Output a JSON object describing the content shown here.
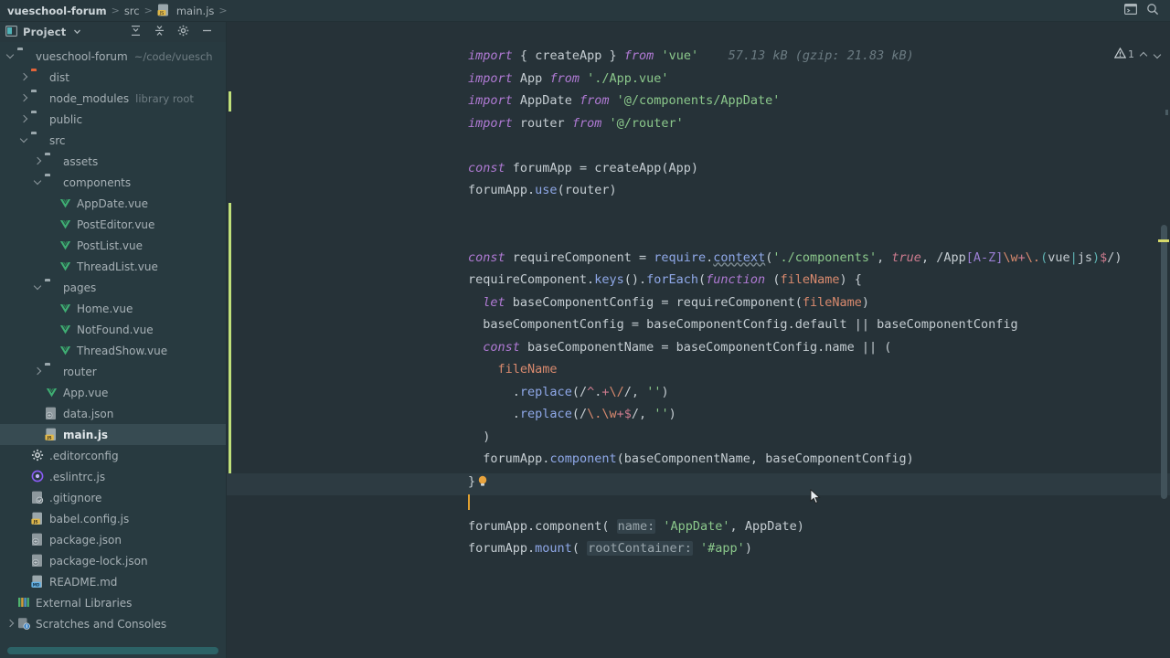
{
  "window": {
    "breadcrumbs": [
      {
        "label": "vueschool-forum",
        "bold": true,
        "icon": "none"
      },
      {
        "label": "src",
        "bold": false,
        "icon": "none"
      },
      {
        "label": "main.js",
        "bold": false,
        "icon": "js-file-icon"
      }
    ],
    "separator": ">",
    "right_icons": [
      {
        "name": "terminal-window-icon"
      },
      {
        "name": "search-icon"
      }
    ]
  },
  "sidebar": {
    "title": "Project",
    "dropdown_icon": "chevron-down-icon",
    "tools": [
      {
        "name": "expand-all-icon"
      },
      {
        "name": "collapse-all-icon"
      },
      {
        "name": "settings-gear-icon"
      },
      {
        "name": "hide-panel-icon"
      }
    ],
    "tree": [
      {
        "label": "vueschool-forum",
        "hint": "~/code/vuesch",
        "depth": 0,
        "arrow": "open",
        "icon": "folder",
        "selected": false
      },
      {
        "label": "dist",
        "hint": "",
        "depth": 1,
        "arrow": "closed",
        "icon": "folder-orange",
        "selected": false
      },
      {
        "label": "node_modules",
        "hint": "library root",
        "depth": 1,
        "arrow": "closed",
        "icon": "folder",
        "selected": false
      },
      {
        "label": "public",
        "hint": "",
        "depth": 1,
        "arrow": "closed",
        "icon": "folder",
        "selected": false
      },
      {
        "label": "src",
        "hint": "",
        "depth": 1,
        "arrow": "open",
        "icon": "folder",
        "selected": false
      },
      {
        "label": "assets",
        "hint": "",
        "depth": 2,
        "arrow": "closed",
        "icon": "folder",
        "selected": false
      },
      {
        "label": "components",
        "hint": "",
        "depth": 2,
        "arrow": "open",
        "icon": "folder",
        "selected": false
      },
      {
        "label": "AppDate.vue",
        "hint": "",
        "depth": 3,
        "arrow": "none",
        "icon": "vue-file-icon",
        "selected": false
      },
      {
        "label": "PostEditor.vue",
        "hint": "",
        "depth": 3,
        "arrow": "none",
        "icon": "vue-file-icon",
        "selected": false
      },
      {
        "label": "PostList.vue",
        "hint": "",
        "depth": 3,
        "arrow": "none",
        "icon": "vue-file-icon",
        "selected": false
      },
      {
        "label": "ThreadList.vue",
        "hint": "",
        "depth": 3,
        "arrow": "none",
        "icon": "vue-file-icon",
        "selected": false
      },
      {
        "label": "pages",
        "hint": "",
        "depth": 2,
        "arrow": "open",
        "icon": "folder",
        "selected": false
      },
      {
        "label": "Home.vue",
        "hint": "",
        "depth": 3,
        "arrow": "none",
        "icon": "vue-file-icon",
        "selected": false
      },
      {
        "label": "NotFound.vue",
        "hint": "",
        "depth": 3,
        "arrow": "none",
        "icon": "vue-file-icon",
        "selected": false
      },
      {
        "label": "ThreadShow.vue",
        "hint": "",
        "depth": 3,
        "arrow": "none",
        "icon": "vue-file-icon",
        "selected": false
      },
      {
        "label": "router",
        "hint": "",
        "depth": 2,
        "arrow": "closed",
        "icon": "folder",
        "selected": false
      },
      {
        "label": "App.vue",
        "hint": "",
        "depth": 2,
        "arrow": "none",
        "icon": "vue-file-icon",
        "selected": false
      },
      {
        "label": "data.json",
        "hint": "",
        "depth": 2,
        "arrow": "none",
        "icon": "json-file-icon",
        "selected": false
      },
      {
        "label": "main.js",
        "hint": "",
        "depth": 2,
        "arrow": "none",
        "icon": "js-file-icon",
        "selected": true
      },
      {
        "label": ".editorconfig",
        "hint": "",
        "depth": 1,
        "arrow": "none",
        "icon": "gear-file-icon",
        "selected": false
      },
      {
        "label": ".eslintrc.js",
        "hint": "",
        "depth": 1,
        "arrow": "none",
        "icon": "eslint-file-icon",
        "selected": false
      },
      {
        "label": ".gitignore",
        "hint": "",
        "depth": 1,
        "arrow": "none",
        "icon": "git-file-icon",
        "selected": false
      },
      {
        "label": "babel.config.js",
        "hint": "",
        "depth": 1,
        "arrow": "none",
        "icon": "js-file-icon",
        "selected": false
      },
      {
        "label": "package.json",
        "hint": "",
        "depth": 1,
        "arrow": "none",
        "icon": "json-file-icon",
        "selected": false
      },
      {
        "label": "package-lock.json",
        "hint": "",
        "depth": 1,
        "arrow": "none",
        "icon": "json-file-icon",
        "selected": false
      },
      {
        "label": "README.md",
        "hint": "",
        "depth": 1,
        "arrow": "none",
        "icon": "md-file-icon",
        "selected": false
      },
      {
        "label": "External Libraries",
        "hint": "",
        "depth": 0,
        "arrow": "none",
        "icon": "libraries-icon",
        "selected": false
      },
      {
        "label": "Scratches and Consoles",
        "hint": "",
        "depth": 0,
        "arrow": "closed",
        "icon": "scratches-icon",
        "selected": false
      }
    ]
  },
  "editor": {
    "file": "main.js",
    "inlay_hint_bundle": "57.13 kB (gzip: 21.83 kB)",
    "parameter_hints": [
      "name:",
      "rootContainer:"
    ],
    "cursor_line_text": "",
    "lightbulb_icon": "intention-bulb-icon",
    "lines": [
      "import { createApp } from 'vue'    57.13 kB (gzip: 21.83 kB)",
      "import App from './App.vue'",
      "import AppDate from '@/components/AppDate'",
      "import router from '@/router'",
      "",
      "const forumApp = createApp(App)",
      "forumApp.use(router)",
      "",
      "",
      "const requireComponent = require.context('./components', true, /App[A-Z]\\w+\\.(vue|js)$/)",
      "requireComponent.keys().forEach(function (fileName) {",
      "  let baseComponentConfig = requireComponent(fileName)",
      "  baseComponentConfig = baseComponentConfig.default || baseComponentConfig",
      "  const baseComponentName = baseComponentConfig.name || (",
      "    fileName",
      "      .replace(/^.+\\//, '')",
      "      .replace(/\\.\\w+$/, '')",
      "  )",
      "  forumApp.component(baseComponentName, baseComponentConfig)",
      "}",
      "",
      "forumApp.component( name: 'AppDate', AppDate)",
      "forumApp.mount( rootContainer: '#app')"
    ]
  },
  "inspection_widget": {
    "warning_icon": "warning-triangle-icon",
    "warning_count": "1",
    "prev_icon": "chevron-up-icon",
    "next_icon": "chevron-down-icon"
  },
  "colors": {
    "editor_bg": "#263238",
    "sidebar_bg": "#283a40",
    "topbar_bg": "#28383e",
    "selection": "#374b52",
    "change_marker": "#c0e07a",
    "caret": "#e0a030",
    "scrollbar": "#2d6a6d",
    "keyword": "#b07ad4",
    "string": "#8bc88b",
    "function": "#8fa8e8",
    "parameter": "#d98a6e"
  }
}
